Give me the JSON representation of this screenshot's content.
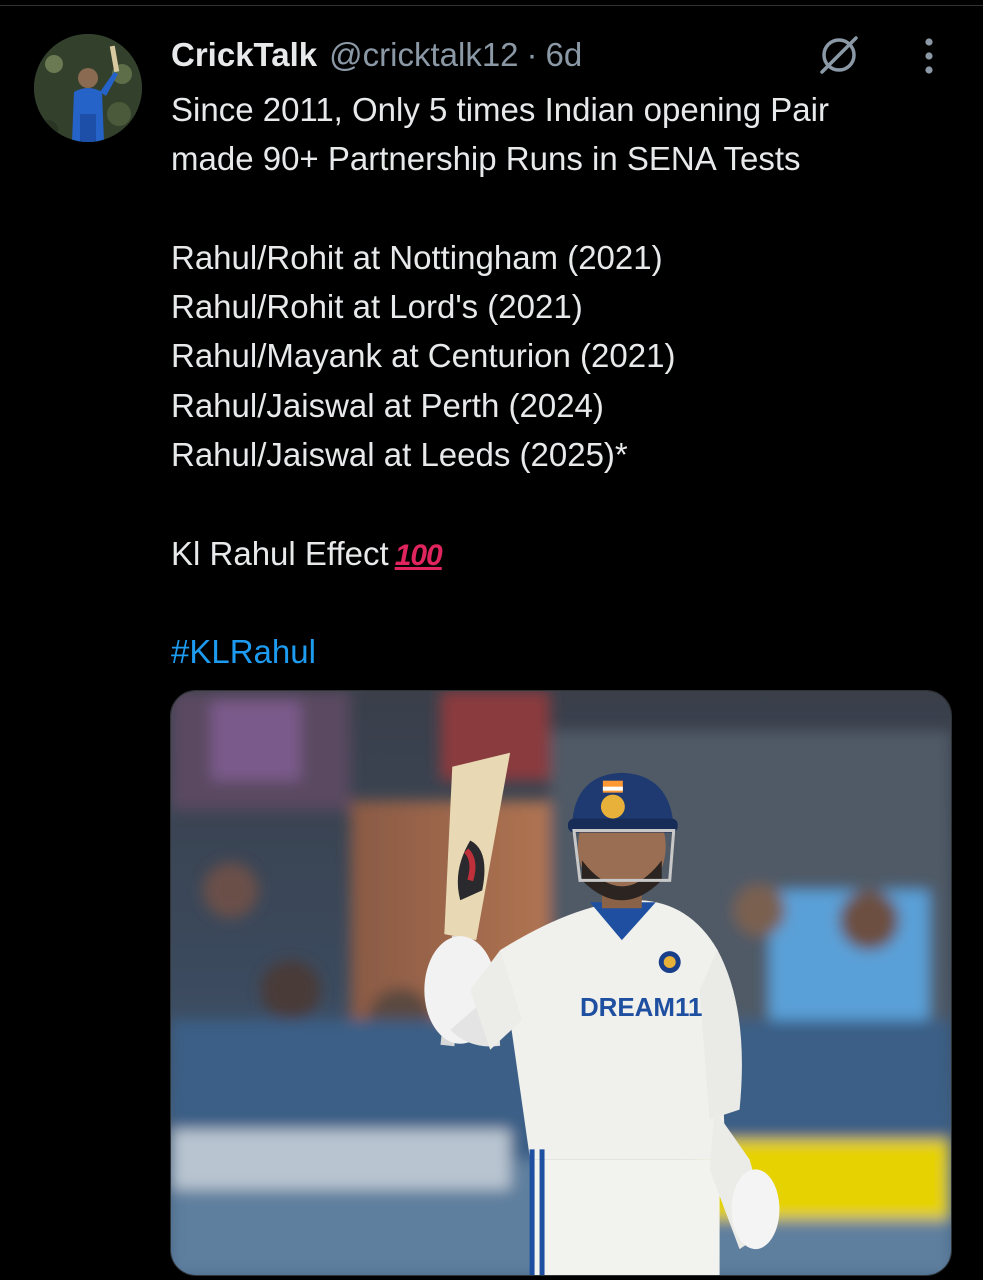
{
  "tweet": {
    "author": {
      "display_name": "CrickTalk",
      "handle": "@cricktalk12",
      "separator": "·",
      "time": "6d",
      "avatar_icon": "avatar-cricketer-photo"
    },
    "header_icons": {
      "grok": "grok-slash-icon",
      "more": "more-vertical-icon"
    },
    "text": {
      "intro_line1": "Since 2011, Only 5 times Indian opening Pair",
      "intro_line2": "made 90+ Partnership Runs in SENA Tests",
      "list": [
        "Rahul/Rohit at Nottingham (2021)",
        "Rahul/Rohit at Lord's (2021)",
        "Rahul/Mayank at Centurion (2021)",
        "Rahul/Jaiswal at Perth (2024)",
        "Rahul/Jaiswal at Leeds (2025)*"
      ],
      "effect": "Kl Rahul Effect",
      "emoji": "100",
      "hashtag": "#KLRahul"
    },
    "media": {
      "jersey_text": "DREAM11"
    },
    "colors": {
      "background": "#000000",
      "text": "#e7e9ea",
      "secondary": "#8b98a5",
      "link": "#1d9bf0",
      "emoji": "#e0245e"
    }
  }
}
